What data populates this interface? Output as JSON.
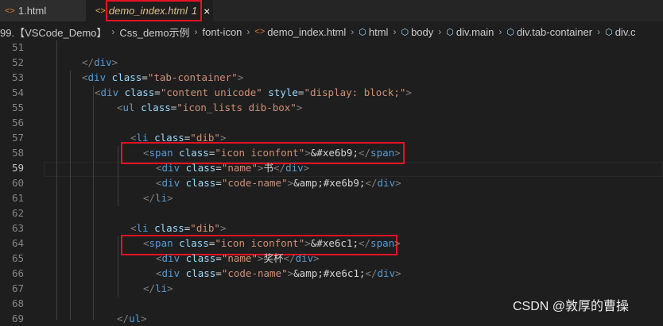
{
  "tabs": [
    {
      "icon": "html-icon",
      "label": "1.html"
    },
    {
      "icon": "html-icon",
      "label": "demo_index.html",
      "badge": "1",
      "close": "×"
    }
  ],
  "breadcrumb": [
    "99.【VSCode_Demo】",
    "Css_demo示例",
    "font-icon",
    "demo_index.html",
    "html",
    "body",
    "div.main",
    "div.tab-container",
    "div.c"
  ],
  "lines": [
    {
      "n": "51",
      "parts": []
    },
    {
      "n": "52",
      "parts": [
        [
          "t",
          "</"
        ],
        [
          "tg",
          "div"
        ],
        [
          "t",
          ">"
        ]
      ]
    },
    {
      "n": "53",
      "parts": [
        [
          "t",
          "<"
        ],
        [
          "tg",
          "div"
        ],
        [
          "tx",
          " "
        ],
        [
          "at",
          "class"
        ],
        [
          "tx",
          "="
        ],
        [
          "sv",
          "\"tab-container\""
        ],
        [
          "t",
          ">"
        ]
      ]
    },
    {
      "n": "54",
      "parts": [
        [
          "t",
          "<"
        ],
        [
          "tg",
          "div"
        ],
        [
          "tx",
          " "
        ],
        [
          "at",
          "class"
        ],
        [
          "tx",
          "="
        ],
        [
          "sv",
          "\"content unicode\""
        ],
        [
          "tx",
          " "
        ],
        [
          "at",
          "style"
        ],
        [
          "tx",
          "="
        ],
        [
          "sv",
          "\"display: block;\""
        ],
        [
          "t",
          ">"
        ]
      ]
    },
    {
      "n": "55",
      "parts": [
        [
          "t",
          "<"
        ],
        [
          "tg",
          "ul"
        ],
        [
          "tx",
          " "
        ],
        [
          "at",
          "class"
        ],
        [
          "tx",
          "="
        ],
        [
          "sv",
          "\"icon_lists dib-box\""
        ],
        [
          "t",
          ">"
        ]
      ]
    },
    {
      "n": "56",
      "parts": []
    },
    {
      "n": "57",
      "parts": [
        [
          "t",
          "<"
        ],
        [
          "tg",
          "li"
        ],
        [
          "tx",
          " "
        ],
        [
          "at",
          "class"
        ],
        [
          "tx",
          "="
        ],
        [
          "sv",
          "\"dib\""
        ],
        [
          "t",
          ">"
        ]
      ]
    },
    {
      "n": "58",
      "parts": [
        [
          "t",
          "<"
        ],
        [
          "tg",
          "span"
        ],
        [
          "tx",
          " "
        ],
        [
          "at",
          "class"
        ],
        [
          "tx",
          "="
        ],
        [
          "sv",
          "\"icon iconfont\""
        ],
        [
          "t",
          ">"
        ],
        [
          "tx",
          "&#xe6b9;"
        ],
        [
          "t",
          "</"
        ],
        [
          "tg",
          "span"
        ],
        [
          "t",
          ">"
        ]
      ]
    },
    {
      "n": "59",
      "parts": [
        [
          "t",
          "<"
        ],
        [
          "tg",
          "div"
        ],
        [
          "tx",
          " "
        ],
        [
          "at",
          "class"
        ],
        [
          "tx",
          "="
        ],
        [
          "sv",
          "\"name\""
        ],
        [
          "t",
          ">"
        ],
        [
          "tx",
          "书"
        ],
        [
          "t",
          "</"
        ],
        [
          "tg",
          "div"
        ],
        [
          "t",
          ">"
        ]
      ]
    },
    {
      "n": "60",
      "parts": [
        [
          "t",
          "<"
        ],
        [
          "tg",
          "div"
        ],
        [
          "tx",
          " "
        ],
        [
          "at",
          "class"
        ],
        [
          "tx",
          "="
        ],
        [
          "sv",
          "\"code-name\""
        ],
        [
          "t",
          ">"
        ],
        [
          "tx",
          "&amp;#xe6b9;"
        ],
        [
          "t",
          "</"
        ],
        [
          "tg",
          "div"
        ],
        [
          "t",
          ">"
        ]
      ]
    },
    {
      "n": "61",
      "parts": [
        [
          "t",
          "</"
        ],
        [
          "tg",
          "li"
        ],
        [
          "t",
          ">"
        ]
      ]
    },
    {
      "n": "62",
      "parts": []
    },
    {
      "n": "63",
      "parts": [
        [
          "t",
          "<"
        ],
        [
          "tg",
          "li"
        ],
        [
          "tx",
          " "
        ],
        [
          "at",
          "class"
        ],
        [
          "tx",
          "="
        ],
        [
          "sv",
          "\"dib\""
        ],
        [
          "t",
          ">"
        ]
      ]
    },
    {
      "n": "64",
      "parts": [
        [
          "t",
          "<"
        ],
        [
          "tg",
          "span"
        ],
        [
          "tx",
          " "
        ],
        [
          "at",
          "class"
        ],
        [
          "tx",
          "="
        ],
        [
          "sv",
          "\"icon iconfont\""
        ],
        [
          "t",
          ">"
        ],
        [
          "tx",
          "&#xe6c1;"
        ],
        [
          "t",
          "</"
        ],
        [
          "tg",
          "span"
        ],
        [
          "t",
          ">"
        ]
      ]
    },
    {
      "n": "65",
      "parts": [
        [
          "t",
          "<"
        ],
        [
          "tg",
          "div"
        ],
        [
          "tx",
          " "
        ],
        [
          "at",
          "class"
        ],
        [
          "tx",
          "="
        ],
        [
          "sv",
          "\"name\""
        ],
        [
          "t",
          ">"
        ],
        [
          "tx",
          "奖杯"
        ],
        [
          "t",
          "</"
        ],
        [
          "tg",
          "div"
        ],
        [
          "t",
          ">"
        ]
      ]
    },
    {
      "n": "66",
      "parts": [
        [
          "t",
          "<"
        ],
        [
          "tg",
          "div"
        ],
        [
          "tx",
          " "
        ],
        [
          "at",
          "class"
        ],
        [
          "tx",
          "="
        ],
        [
          "sv",
          "\"code-name\""
        ],
        [
          "t",
          ">"
        ],
        [
          "tx",
          "&amp;#xe6c1;"
        ],
        [
          "t",
          "</"
        ],
        [
          "tg",
          "div"
        ],
        [
          "t",
          ">"
        ]
      ]
    },
    {
      "n": "67",
      "parts": [
        [
          "t",
          "</"
        ],
        [
          "tg",
          "li"
        ],
        [
          "t",
          ">"
        ]
      ]
    },
    {
      "n": "68",
      "parts": []
    },
    {
      "n": "69",
      "parts": [
        [
          "t",
          "</"
        ],
        [
          "tg",
          "ul"
        ],
        [
          "t",
          ">"
        ]
      ]
    }
  ],
  "watermark": "CSDN @敦厚的曹操",
  "colors": {
    "highlight": "#e81123",
    "tag": "#569cd6",
    "attr": "#9cdcfe",
    "string": "#ce9178"
  }
}
